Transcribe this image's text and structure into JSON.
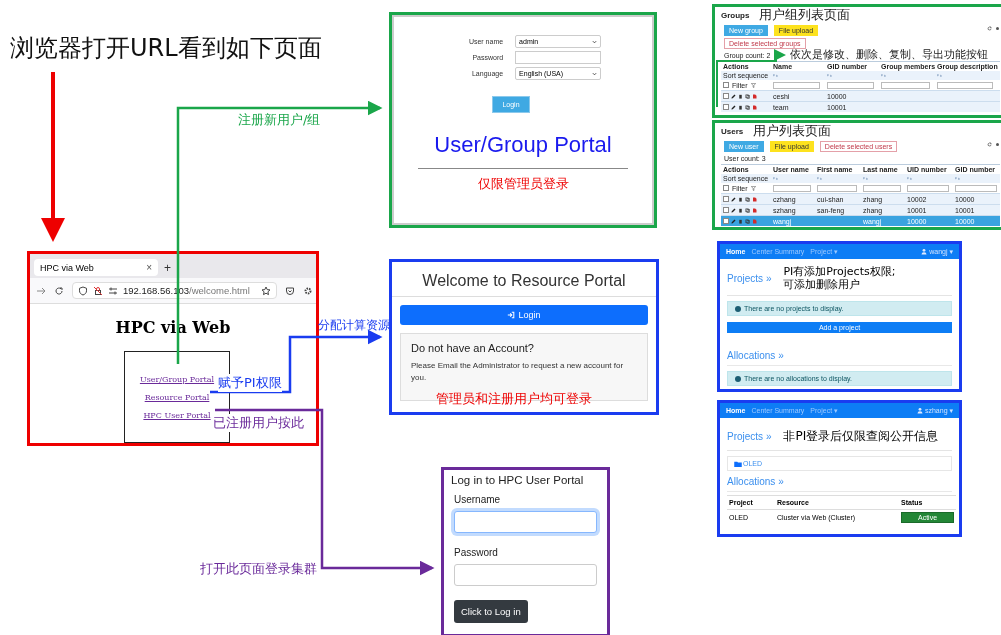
{
  "heading": "浏览器打开URL看到如下页面",
  "browser": {
    "tab_title": "HPC via Web",
    "tab_close": "×",
    "new_tab": "+",
    "url_host": "192.168.56.103",
    "url_path": "/welcome.html",
    "page_title": "HPC via Web",
    "links": [
      "User/Group Portal",
      "Resource Portal",
      "HPC User Portal"
    ]
  },
  "arrow_labels": [
    {
      "text": "注册新用户/组",
      "color": "#1aa64a"
    },
    {
      "text": "分配计算资源",
      "color": "#1a3cf0"
    },
    {
      "text": "赋予PI权限",
      "color": "#1a3cf0"
    },
    {
      "text": "已注册用户按此",
      "color": "#6a2a9a"
    },
    {
      "text": "打开此页面登录集群",
      "color": "#6a2a9a"
    }
  ],
  "usergroup_login": {
    "fields": [
      {
        "label": "User name",
        "value": "admin",
        "kind": "select"
      },
      {
        "label": "Password",
        "kind": "text"
      },
      {
        "label": "Language",
        "value": "English (USA)",
        "kind": "select"
      }
    ],
    "button": "Login",
    "title": "User/Group Portal",
    "note": "仅限管理员登录"
  },
  "resource_login": {
    "title": "Welcome to Resource Portal",
    "button": "Login",
    "card_title": "Do not have an Account?",
    "card_text": "Please Email the Administrator to request a new account for you.",
    "note": "管理员和注册用户均可登录"
  },
  "hpc_login": {
    "title": "Log in to HPC User Portal",
    "fields": [
      {
        "label": "Username",
        "focused": true
      },
      {
        "label": "Password",
        "focused": false
      }
    ],
    "button": "Click to Log in"
  },
  "groups_page": {
    "title": "Groups",
    "note": "用户组列表页面",
    "buttons": [
      {
        "label": "New group",
        "kind": "primary"
      },
      {
        "label": "File upload",
        "kind": "warning"
      },
      {
        "label": "Delete selected groups",
        "kind": "danger"
      }
    ],
    "count": "Group count: 2",
    "annotation": "依次是修改、删除、复制、导出功能按钮",
    "columns": [
      "Actions",
      "Name",
      "GID number",
      "Group members",
      "Group description"
    ],
    "sort_label": "Sort sequence",
    "filter_label": "Filter",
    "all_checked": false,
    "rows": [
      {
        "cells": [
          "",
          "ceshi",
          "10000",
          "",
          ""
        ],
        "checked": false,
        "selected": false
      },
      {
        "cells": [
          "",
          "team",
          "10001",
          "",
          ""
        ],
        "checked": false,
        "selected": false
      }
    ]
  },
  "users_page": {
    "title": "Users",
    "note": "用户列表页面",
    "buttons": [
      {
        "label": "New user",
        "kind": "primary"
      },
      {
        "label": "File upload",
        "kind": "warning"
      },
      {
        "label": "Delete selected users",
        "kind": "danger"
      }
    ],
    "count": "User count: 3",
    "columns": [
      "Actions",
      "User name",
      "First name",
      "Last name",
      "UID number",
      "GID number"
    ],
    "sort_label": "Sort sequence",
    "filter_label": "Filter",
    "all_checked": false,
    "rows": [
      {
        "cells": [
          "",
          "czhang",
          "cui-shan",
          "zhang",
          "10002",
          "10000"
        ],
        "checked": false,
        "selected": false
      },
      {
        "cells": [
          "",
          "szhang",
          "san-feng",
          "zhang",
          "10001",
          "10001"
        ],
        "checked": false,
        "selected": false
      },
      {
        "cells": [
          "",
          "wangj",
          "",
          "wangj",
          "10000",
          "10000"
        ],
        "checked": false,
        "selected": true
      }
    ]
  },
  "projects_pi": {
    "nav": [
      {
        "label": "Home",
        "selected": true
      },
      {
        "label": "Center Summary",
        "selected": false
      },
      {
        "label": "Project ▾",
        "selected": false
      }
    ],
    "user": "wangj ▾",
    "projects_heading": "Projects »",
    "note": [
      "PI有添加Projects权限;",
      "可添加删除用户"
    ],
    "projects_info": "There are no projects to display.",
    "add_button": "Add a project",
    "allocations_heading": "Allocations »",
    "allocations_info": "There are no allocations to display."
  },
  "projects_user": {
    "nav": [
      {
        "label": "Home",
        "selected": true
      },
      {
        "label": "Center Summary",
        "selected": false
      },
      {
        "label": "Project ▾",
        "selected": false
      }
    ],
    "user": "szhang ▾",
    "projects_heading": "Projects »",
    "note": "非PI登录后仅限查阅公开信息",
    "project": "OLED",
    "allocations_heading": "Allocations »",
    "columns": [
      "Project",
      "Resource",
      "Status"
    ],
    "rows": [
      {
        "project": "OLED",
        "resource": "Cluster via Web (Cluster)",
        "status": "Active"
      }
    ]
  }
}
